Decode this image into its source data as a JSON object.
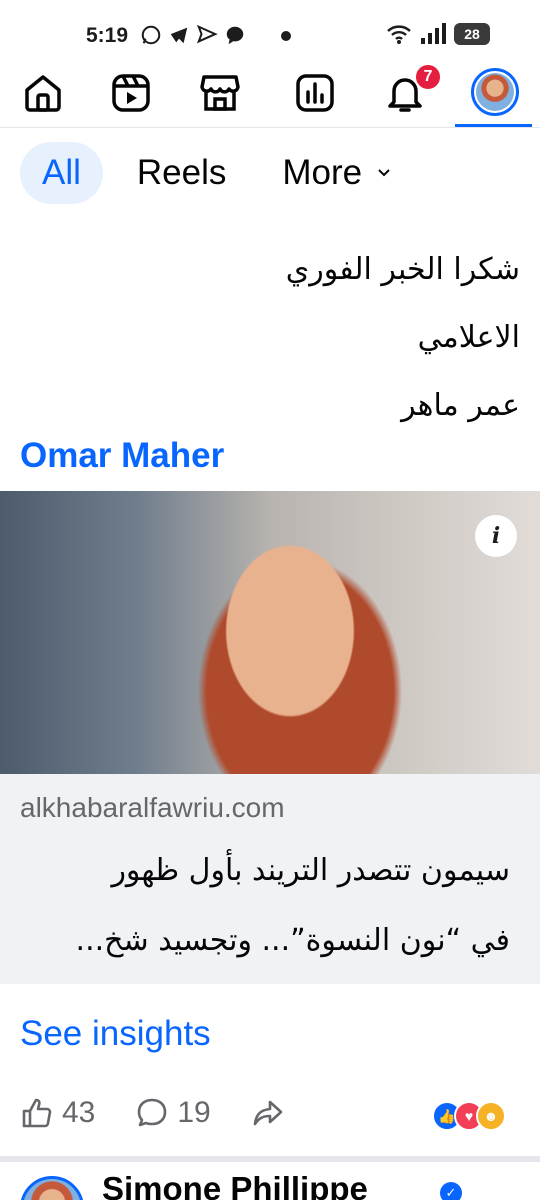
{
  "status_bar": {
    "time": "5:19",
    "battery": "28",
    "left_icons": [
      "whatsapp-icon",
      "telegram-icon",
      "send-icon",
      "messenger-icon"
    ],
    "right_icons": [
      "wifi-icon",
      "signal-icon",
      "battery-icon"
    ]
  },
  "nav": {
    "items": [
      "home-icon",
      "reels-icon",
      "marketplace-icon",
      "dashboard-icon",
      "notifications-icon",
      "profile-avatar"
    ],
    "notification_count": "7",
    "active_color": "#0866ff"
  },
  "filters": {
    "all": "All",
    "reels": "Reels",
    "more": "More"
  },
  "post": {
    "text_lines": [
      "شكرا الخبر الفوري",
      "الاعلامي",
      "عمر ماهر"
    ],
    "author_link": "Omar Maher"
  },
  "link_preview": {
    "domain": "alkhabaralfawriu.com",
    "title_line1": "سيمون تتصدر التريند بأول ظهور",
    "title_line2": "في “نون النسوة”... وتجسيد شخ..."
  },
  "insights": {
    "label": "See insights"
  },
  "engagement": {
    "likes": "43",
    "comments": "19",
    "reactions": [
      "like",
      "love",
      "care"
    ]
  },
  "next_post": {
    "name": "Simone Phillippe"
  }
}
